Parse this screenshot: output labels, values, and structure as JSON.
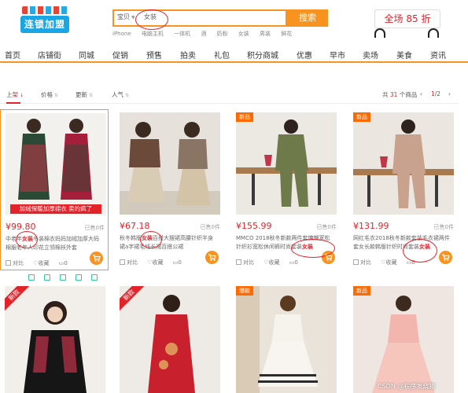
{
  "header": {
    "logo_text": "连锁加盟",
    "search_category": "宝贝",
    "search_keyword": "女装",
    "search_button": "搜索",
    "hotwords": [
      "iPhone",
      "电脑主机",
      "一体机",
      "酒",
      "奶粉",
      "女装",
      "男装",
      "鲜花"
    ],
    "promo_text": "全场 85 折"
  },
  "nav": [
    "首页",
    "店铺街",
    "同城",
    "促销",
    "预售",
    "拍卖",
    "礼包",
    "积分商城",
    "优惠",
    "早市",
    "卖场",
    "美食",
    "资讯"
  ],
  "sortbar": {
    "options": [
      "上架",
      "价格",
      "更新",
      "人气"
    ],
    "active_index": 0,
    "total_prefix": "共",
    "total_count": "31",
    "total_suffix": "个商品",
    "page_current": "1",
    "page_total": "/2"
  },
  "products": [
    {
      "price": "¥99.80",
      "sold": "已售0件",
      "title_a": "中老年",
      "title_hl": "女装",
      "title_b": "冬装棉衣妈妈加绒加厚大码棉服老年人印花立领棉袄外套",
      "banner": "加绒保暖加厚棉衣 卖的疯了",
      "compare": "对比",
      "fav": "收藏",
      "comments": "0"
    },
    {
      "price": "¥67.18",
      "sold": "已售0件",
      "title_a": "秋冬韩版",
      "title_hl": "女装",
      "title_b": "百搭大摆裙高腰针织半身裙a字裙毛线长裙百搭公裙",
      "compare": "对比",
      "fav": "收藏",
      "comments": "0"
    },
    {
      "price": "¥155.99",
      "sold": "已售0件",
      "title_a": "MMCO 2018秋冬新款两件套慵懒宽松针织衫宽松休闲裤时尚套装",
      "title_hl": "女装",
      "title_b": "",
      "badge": "新品",
      "compare": "对比",
      "fav": "收藏",
      "comments": "0"
    },
    {
      "price": "¥131.99",
      "sold": "已售0件",
      "title_a": "网红毛衣2018秋冬新款套装毛衣裙两件套女长款韩版针织时尚套装",
      "title_hl": "女装",
      "title_b": "",
      "badge": "新品",
      "compare": "对比",
      "fav": "收藏",
      "comments": "0"
    },
    {
      "corner": "新款"
    },
    {
      "corner": "新款"
    },
    {
      "badge": "爆款"
    },
    {
      "badge": "新品"
    }
  ],
  "watermark": "CSDN @程序发烧猿",
  "colors": {
    "accent": "#f7931e",
    "price": "#e2232a"
  }
}
